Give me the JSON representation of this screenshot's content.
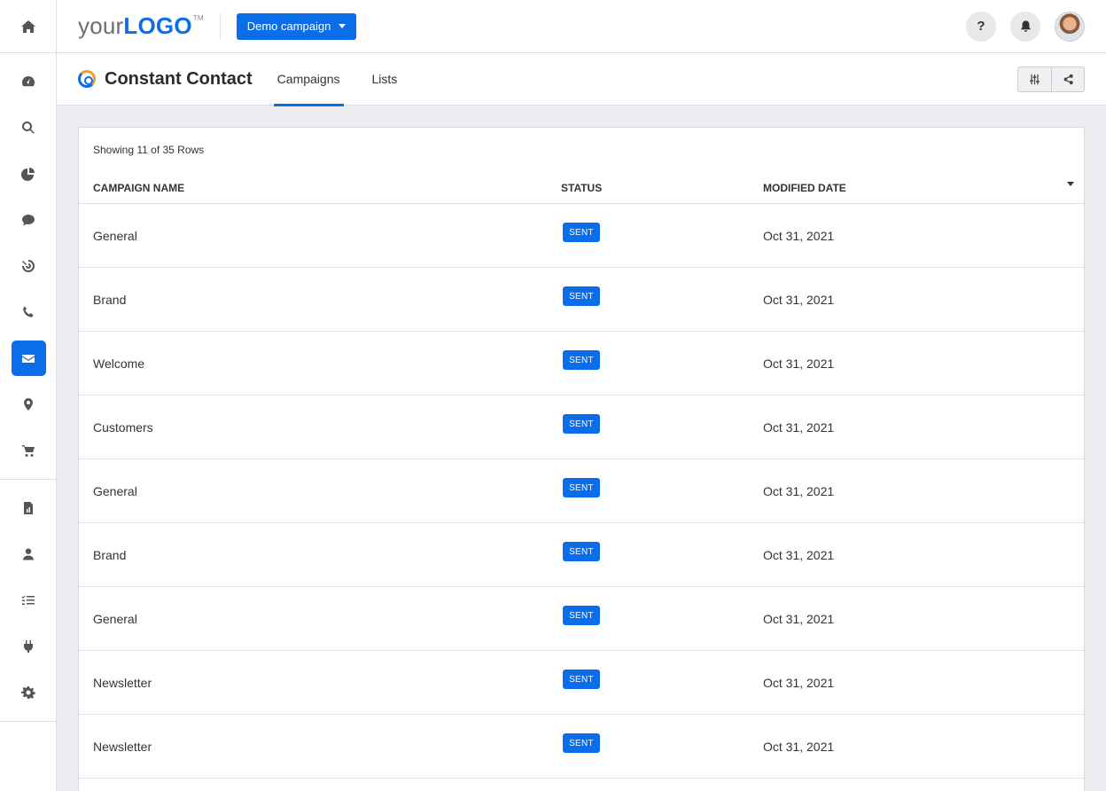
{
  "rail": {
    "home": "home-icon",
    "group1": [
      "dashboard-icon",
      "search-icon",
      "pie-chart-icon",
      "chat-icon",
      "target-icon",
      "phone-icon",
      "envelope-icon",
      "map-pin-icon",
      "cart-icon"
    ],
    "active": "envelope-icon",
    "group2": [
      "report-icon",
      "user-icon",
      "checklist-icon",
      "plug-icon",
      "gear-icon"
    ]
  },
  "header": {
    "logo_prefix": "your",
    "logo_main": "LOGO",
    "logo_tm": "TM",
    "campaign_label": "Demo campaign",
    "help_label": "?"
  },
  "subheader": {
    "brand": "Constant Contact",
    "tabs": [
      {
        "label": "Campaigns",
        "active": true
      },
      {
        "label": "Lists",
        "active": false
      }
    ]
  },
  "table": {
    "showing": "Showing 11 of 35 Rows",
    "columns": [
      "CAMPAIGN NAME",
      "STATUS",
      "MODIFIED DATE"
    ],
    "rows": [
      {
        "name": "General",
        "status": "SENT",
        "date": "Oct 31, 2021"
      },
      {
        "name": "Brand",
        "status": "SENT",
        "date": "Oct 31, 2021"
      },
      {
        "name": "Welcome",
        "status": "SENT",
        "date": "Oct 31, 2021"
      },
      {
        "name": "Customers",
        "status": "SENT",
        "date": "Oct 31, 2021"
      },
      {
        "name": "General",
        "status": "SENT",
        "date": "Oct 31, 2021"
      },
      {
        "name": "Brand",
        "status": "SENT",
        "date": "Oct 31, 2021"
      },
      {
        "name": "General",
        "status": "SENT",
        "date": "Oct 31, 2021"
      },
      {
        "name": "Newsletter",
        "status": "SENT",
        "date": "Oct 31, 2021"
      },
      {
        "name": "Newsletter",
        "status": "SENT",
        "date": "Oct 31, 2021"
      }
    ]
  },
  "colors": {
    "accent": "#0b6ee8",
    "brand_orange": "#f59a23"
  }
}
